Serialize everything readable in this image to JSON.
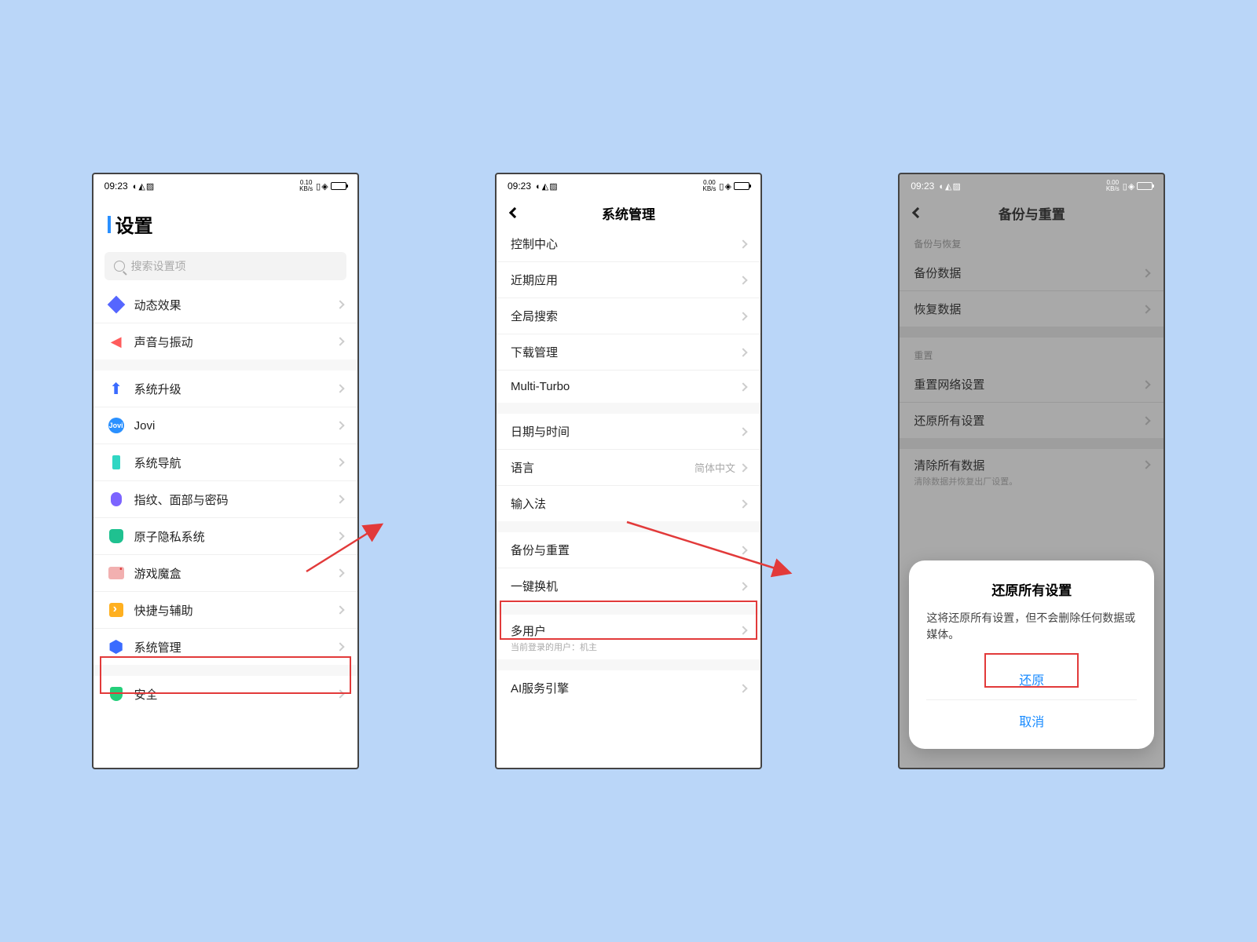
{
  "status": {
    "time": "09:23",
    "net1": "0.10",
    "net2": "0.00",
    "net3": "0.00",
    "unit": "KB/s"
  },
  "screen1": {
    "title": "设置",
    "search_placeholder": "搜索设置项",
    "items": {
      "dynamic": "动态效果",
      "sound": "声音与振动",
      "upgrade": "系统升级",
      "jovi": "Jovi",
      "nav": "系统导航",
      "finger": "指纹、面部与密码",
      "privacy": "原子隐私系统",
      "game": "游戏魔盒",
      "quick": "快捷与辅助",
      "sysmgmt": "系统管理",
      "security": "安全"
    }
  },
  "screen2": {
    "title": "系统管理",
    "items": {
      "control": "控制中心",
      "recent": "近期应用",
      "gsearch": "全局搜索",
      "download": "下载管理",
      "multi": "Multi-Turbo",
      "datetime": "日期与时间",
      "lang": "语言",
      "lang_value": "简体中文",
      "ime": "输入法",
      "backup": "备份与重置",
      "clone": "一键换机",
      "users": "多用户",
      "users_sub": "当前登录的用户：机主",
      "ai": "AI服务引擎"
    }
  },
  "screen3": {
    "title": "备份与重置",
    "sections": {
      "backup_head": "备份与恢复",
      "reset_head": "重置"
    },
    "items": {
      "backup_data": "备份数据",
      "restore_data": "恢复数据",
      "reset_net": "重置网络设置",
      "reset_all": "还原所有设置",
      "erase_all": "清除所有数据",
      "erase_sub": "清除数据并恢复出厂设置。"
    },
    "dialog": {
      "title": "还原所有设置",
      "body": "这将还原所有设置，但不会删除任何数据或媒体。",
      "confirm": "还原",
      "cancel": "取消"
    }
  }
}
